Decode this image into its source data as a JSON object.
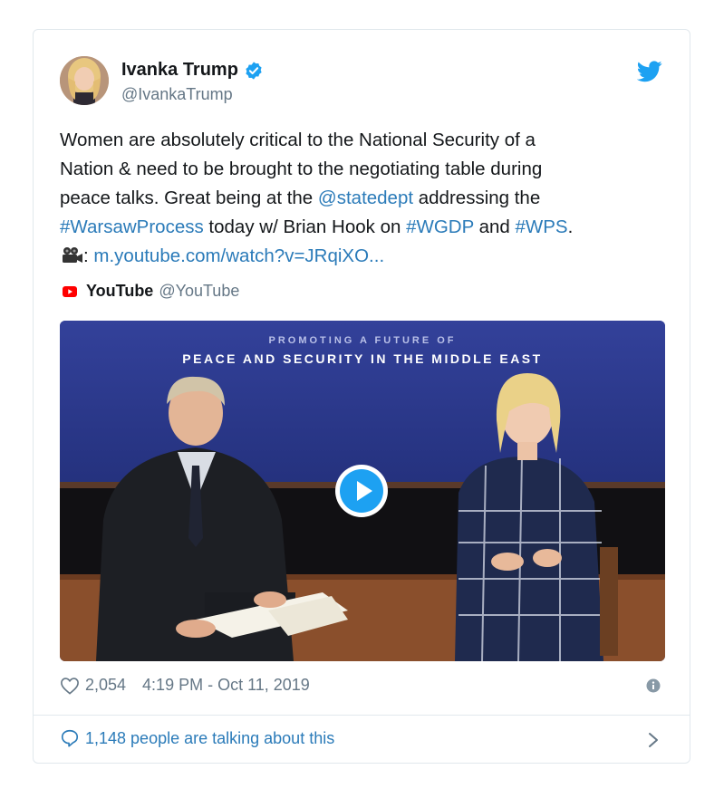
{
  "author": {
    "name": "Ivanka Trump",
    "handle": "@IvankaTrump"
  },
  "tweet": {
    "line1": "Women are absolutely critical to the National Security of a",
    "line2": "Nation & need to be brought to the negotiating table during",
    "line3_pre": "peace talks. Great being at the ",
    "mention": "@statedept",
    "line3_post": " addressing the",
    "hashtag1": "#WarsawProcess",
    "line4_mid": " today w/ Brian Hook on ",
    "hashtag2": "#WGDP",
    "line4_and": " and ",
    "hashtag3": "#WPS",
    "line4_end": ".",
    "cam_colon": ": ",
    "url": "m.youtube.com/watch?v=JRqiXO..."
  },
  "source": {
    "name": "YouTube",
    "handle": "@YouTube"
  },
  "media": {
    "banner_top": "PROMOTING A FUTURE OF",
    "banner_main": "PEACE AND SECURITY IN THE MIDDLE EAST"
  },
  "meta": {
    "likes": "2,054",
    "timestamp": "4:19 PM - Oct 11, 2019"
  },
  "footer": {
    "talking": "1,148 people are talking about this"
  },
  "colors": {
    "link": "#2b7bb9",
    "twitter_blue": "#1da1f2",
    "muted": "#657786",
    "border": "#e1e8ed"
  },
  "icons": [
    "verified-badge-icon",
    "twitter-bird-icon",
    "video-camera-icon",
    "youtube-logo-icon",
    "play-icon",
    "heart-icon",
    "info-icon",
    "comment-bubble-icon",
    "chevron-right-icon"
  ]
}
